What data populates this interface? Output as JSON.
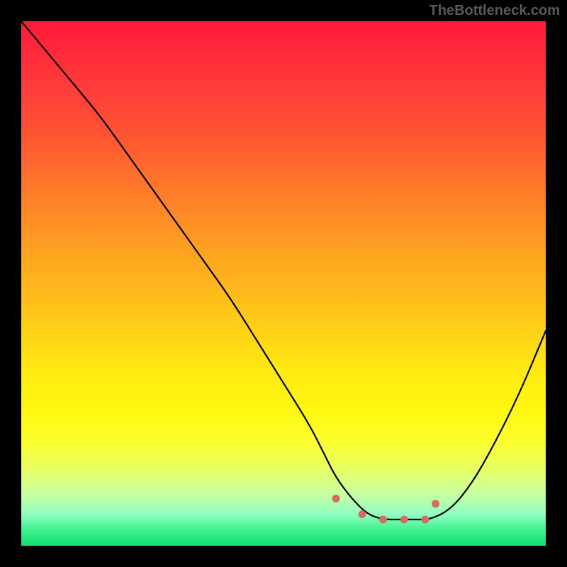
{
  "watermark": "TheBottleneck.com",
  "chart_data": {
    "type": "line",
    "title": "",
    "xlabel": "",
    "ylabel": "",
    "xlim": [
      0,
      100
    ],
    "ylim": [
      0,
      100
    ],
    "series": [
      {
        "name": "curve",
        "x": [
          0,
          5,
          10,
          15,
          20,
          25,
          30,
          35,
          40,
          45,
          50,
          55,
          58,
          60,
          63,
          66,
          69,
          72,
          75,
          78,
          82,
          86,
          90,
          95,
          100
        ],
        "values": [
          100,
          94,
          88,
          82,
          75,
          68,
          61,
          54,
          47,
          39,
          31,
          23,
          17,
          13,
          9,
          6,
          5,
          5,
          5,
          5,
          7,
          12,
          19,
          29,
          41
        ]
      }
    ],
    "markers": [
      {
        "x": 60,
        "y": 9,
        "color": "#d96a60"
      },
      {
        "x": 65,
        "y": 6,
        "color": "#d96a60"
      },
      {
        "x": 69,
        "y": 5,
        "color": "#d96a60"
      },
      {
        "x": 73,
        "y": 5,
        "color": "#d96a60"
      },
      {
        "x": 77,
        "y": 5,
        "color": "#d96a60"
      },
      {
        "x": 79,
        "y": 8,
        "color": "#d96a60"
      }
    ],
    "gradient_stops": [
      {
        "pct": 0,
        "color": "#ff1a3a"
      },
      {
        "pct": 50,
        "color": "#ffb81e"
      },
      {
        "pct": 80,
        "color": "#fcff2c"
      },
      {
        "pct": 100,
        "color": "#10e070"
      }
    ]
  }
}
